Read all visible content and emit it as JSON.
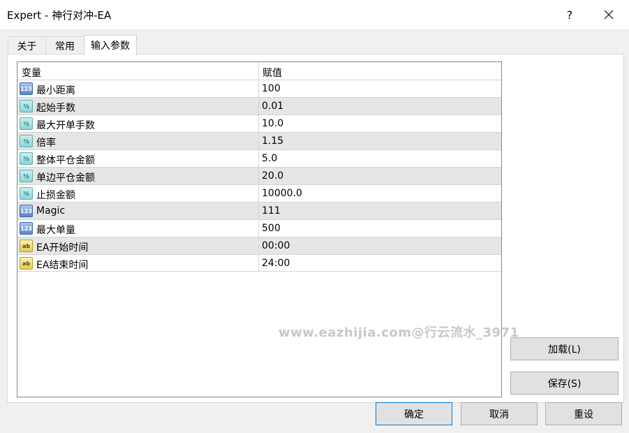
{
  "window": {
    "title": "Expert - 神行对冲-EA",
    "help_label": "?"
  },
  "tabs": [
    {
      "label": "关于"
    },
    {
      "label": "常用"
    },
    {
      "label": "输入参数",
      "active": true
    }
  ],
  "grid": {
    "headers": {
      "variable": "变量",
      "value": "赋值"
    },
    "rows": [
      {
        "type": "int",
        "icon": "int-icon",
        "name": "最小距离",
        "value": "100"
      },
      {
        "type": "double",
        "icon": "double-icon",
        "name": "起始手数",
        "value": "0.01"
      },
      {
        "type": "double",
        "icon": "double-icon",
        "name": "最大开单手数",
        "value": "10.0"
      },
      {
        "type": "double",
        "icon": "double-icon",
        "name": "倍率",
        "value": "1.15"
      },
      {
        "type": "double",
        "icon": "double-icon",
        "name": "整体平仓金额",
        "value": "5.0"
      },
      {
        "type": "double",
        "icon": "double-icon",
        "name": "单边平仓金额",
        "value": "20.0"
      },
      {
        "type": "double",
        "icon": "double-icon",
        "name": "止损金额",
        "value": "10000.0"
      },
      {
        "type": "int",
        "icon": "int-icon",
        "name": "Magic",
        "value": "111"
      },
      {
        "type": "int",
        "icon": "int-icon",
        "name": "最大单量",
        "value": "500"
      },
      {
        "type": "string",
        "icon": "string-icon",
        "name": "EA开始时间",
        "value": "00:00"
      },
      {
        "type": "string",
        "icon": "string-icon",
        "name": "EA结束时间",
        "value": "24:00"
      }
    ]
  },
  "icon_glyphs": {
    "int": "123",
    "double": "½",
    "string": "ab"
  },
  "watermark": "www.eazhijia.com@行云流水_3971",
  "side_buttons": {
    "load": "加载(L)",
    "save": "保存(S)"
  },
  "footer_buttons": {
    "ok": "确定",
    "cancel": "取消",
    "reset": "重设"
  },
  "colors": {
    "primary_border": "#0078d7",
    "alt_row": "#e6e6e6"
  }
}
